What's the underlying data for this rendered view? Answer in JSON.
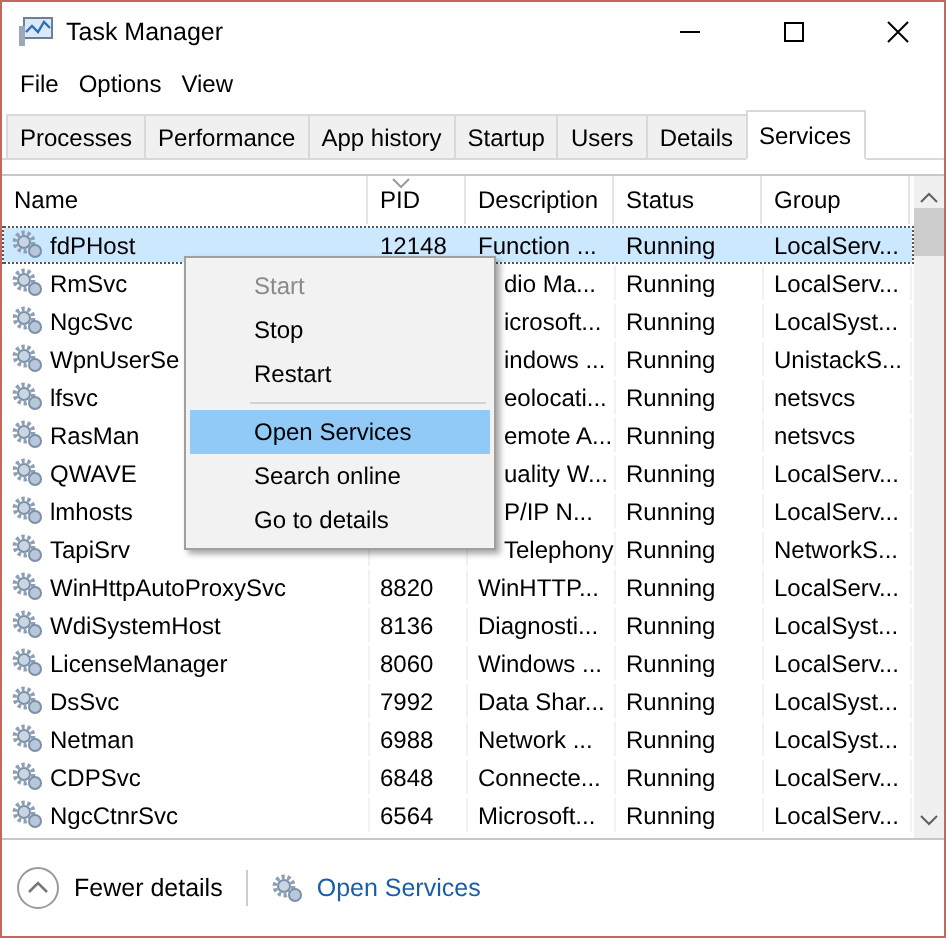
{
  "window": {
    "title": "Task Manager"
  },
  "menu": [
    "File",
    "Options",
    "View"
  ],
  "tabs": [
    {
      "label": "Processes",
      "selected": false
    },
    {
      "label": "Performance",
      "selected": false
    },
    {
      "label": "App history",
      "selected": false
    },
    {
      "label": "Startup",
      "selected": false
    },
    {
      "label": "Users",
      "selected": false
    },
    {
      "label": "Details",
      "selected": false
    },
    {
      "label": "Services",
      "selected": true
    }
  ],
  "table": {
    "columns": [
      {
        "label": "Name",
        "sorted": false
      },
      {
        "label": "PID",
        "sorted": true
      },
      {
        "label": "Description",
        "sorted": false
      },
      {
        "label": "Status",
        "sorted": false
      },
      {
        "label": "Group",
        "sorted": false
      }
    ],
    "rows": [
      {
        "name": "fdPHost",
        "pid": "12148",
        "description": "Function ...",
        "status": "Running",
        "group": "LocalServ...",
        "selected": true
      },
      {
        "name": "RmSvc",
        "description": "dio Ma...",
        "status": "Running",
        "group": "LocalServ...",
        "selected": false
      },
      {
        "name": "NgcSvc",
        "description": "icrosoft...",
        "status": "Running",
        "group": "LocalSyst...",
        "selected": false
      },
      {
        "name": "WpnUserSe",
        "description": "indows ...",
        "status": "Running",
        "group": "UnistackS...",
        "selected": false
      },
      {
        "name": "lfsvc",
        "description": "eolocati...",
        "status": "Running",
        "group": "netsvcs",
        "selected": false
      },
      {
        "name": "RasMan",
        "description": "emote A...",
        "status": "Running",
        "group": "netsvcs",
        "selected": false
      },
      {
        "name": "QWAVE",
        "description": "uality W...",
        "status": "Running",
        "group": "LocalServ...",
        "selected": false
      },
      {
        "name": "lmhosts",
        "description": "P/IP N...",
        "status": "Running",
        "group": "LocalServ...",
        "selected": false
      },
      {
        "name": "TapiSrv",
        "description": "Telephony",
        "status": "Running",
        "group": "NetworkS...",
        "selected": false
      },
      {
        "name": "WinHttpAutoProxySvc",
        "pid": "8820",
        "description": "WinHTTP...",
        "status": "Running",
        "group": "LocalServ...",
        "selected": false
      },
      {
        "name": "WdiSystemHost",
        "pid": "8136",
        "description": "Diagnosti...",
        "status": "Running",
        "group": "LocalSyst...",
        "selected": false
      },
      {
        "name": "LicenseManager",
        "pid": "8060",
        "description": "Windows ...",
        "status": "Running",
        "group": "LocalServ...",
        "selected": false
      },
      {
        "name": "DsSvc",
        "pid": "7992",
        "description": "Data Shar...",
        "status": "Running",
        "group": "LocalSyst...",
        "selected": false
      },
      {
        "name": "Netman",
        "pid": "6988",
        "description": "Network ...",
        "status": "Running",
        "group": "LocalSyst...",
        "selected": false
      },
      {
        "name": "CDPSvc",
        "pid": "6848",
        "description": "Connecte...",
        "status": "Running",
        "group": "LocalServ...",
        "selected": false
      },
      {
        "name": "NgcCtnrSvc",
        "pid": "6564",
        "description": "Microsoft...",
        "status": "Running",
        "group": "LocalServ...",
        "selected": false
      }
    ]
  },
  "context_menu": {
    "groups": [
      [
        {
          "label": "Start",
          "disabled": true,
          "selected": false
        },
        {
          "label": "Stop",
          "disabled": false,
          "selected": false
        },
        {
          "label": "Restart",
          "disabled": false,
          "selected": false
        }
      ],
      [
        {
          "label": "Open Services",
          "disabled": false,
          "selected": true
        },
        {
          "label": "Search online",
          "disabled": false,
          "selected": false
        },
        {
          "label": "Go to details",
          "disabled": false,
          "selected": false
        }
      ]
    ]
  },
  "footer": {
    "toggle": "Fewer details",
    "link": "Open Services"
  }
}
